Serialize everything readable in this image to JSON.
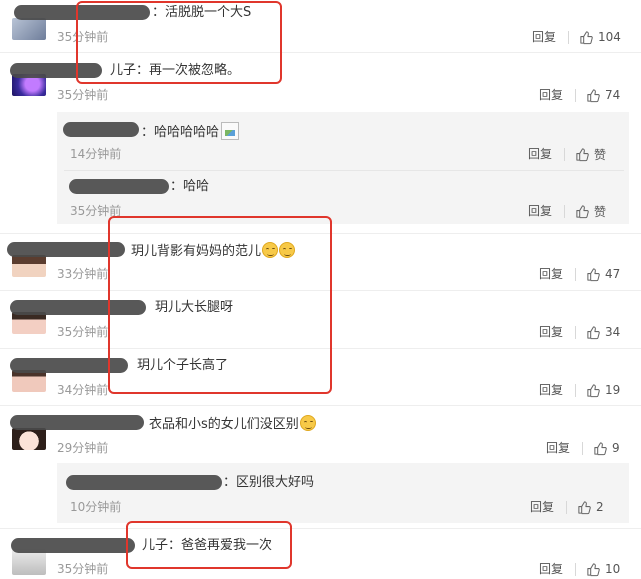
{
  "comments": [
    {
      "content": "：活脱脱一个大S",
      "time": "35分钟前",
      "reply": "回复",
      "likes": "104"
    },
    {
      "content": "儿子：再一次被忽略。",
      "time": "35分钟前",
      "reply": "回复",
      "likes": "74"
    },
    {
      "content": "：哈哈哈哈哈",
      "time": "14分钟前",
      "reply": "回复",
      "likes": "赞"
    },
    {
      "content": "：哈哈",
      "time": "35分钟前",
      "reply": "回复",
      "likes": "赞"
    },
    {
      "content": "玥儿背影有妈妈的范儿",
      "time": "33分钟前",
      "reply": "回复",
      "likes": "47"
    },
    {
      "content": "玥儿大长腿呀",
      "time": "35分钟前",
      "reply": "回复",
      "likes": "34"
    },
    {
      "content": "玥儿个子长高了",
      "time": "34分钟前",
      "reply": "回复",
      "likes": "19"
    },
    {
      "content": "衣品和小s的女儿们没区别",
      "time": "29分钟前",
      "reply": "回复",
      "likes": "9"
    },
    {
      "content": "：区别很大好吗",
      "time": "10分钟前",
      "reply": "回复",
      "likes": "2"
    },
    {
      "content": "儿子：爸爸再爱我一次",
      "time": "35分钟前",
      "reply": "回复",
      "likes": "10"
    }
  ],
  "icons": {
    "like": "thumbs-up-icon",
    "emoji": "smile-emoji-icon",
    "image": "broken-image-icon"
  },
  "colors": {
    "highlight_box": "#e0362c",
    "sub_reply_bg": "#f4f4f4",
    "time_text": "#999999"
  }
}
